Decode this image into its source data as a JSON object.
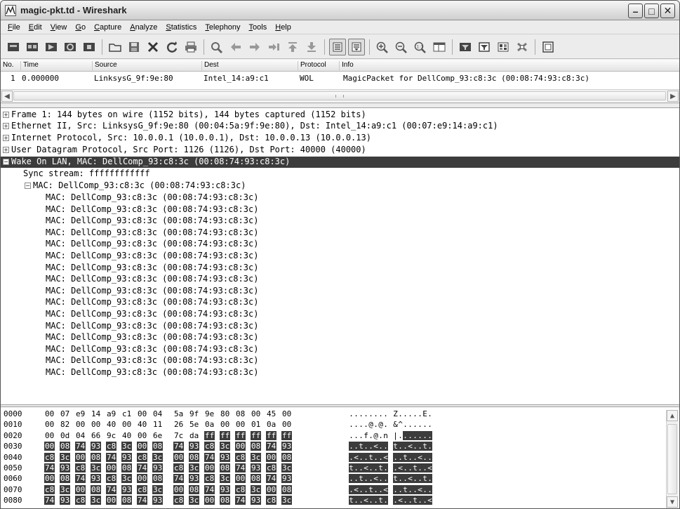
{
  "window": {
    "title": "magic-pkt.td - Wireshark"
  },
  "menu": [
    "File",
    "Edit",
    "View",
    "Go",
    "Capture",
    "Analyze",
    "Statistics",
    "Telephony",
    "Tools",
    "Help"
  ],
  "toolbar": {
    "icons": [
      "interface-list-icon",
      "capture-options-icon",
      "start-capture-icon",
      "restart-capture-icon",
      "stop-capture-icon",
      "open-file-icon",
      "save-file-icon",
      "close-file-icon",
      "reload-icon",
      "print-icon",
      "find-packet-icon",
      "go-back-icon",
      "go-forward-icon",
      "go-to-packet-icon",
      "go-first-icon",
      "go-last-icon",
      "colorize-icon",
      "autoscroll-icon",
      "zoom-in-icon",
      "zoom-out-icon",
      "zoom-normal-icon",
      "resize-columns-icon",
      "capture-filters-icon",
      "display-filters-icon",
      "coloring-rules-icon",
      "preferences-icon",
      "help-icon"
    ]
  },
  "packet_list": {
    "columns": [
      "No.",
      "Time",
      "Source",
      "Dest",
      "Protocol",
      "Info"
    ],
    "rows": [
      {
        "no": "1",
        "time": "0.000000",
        "source": "LinksysG_9f:9e:80",
        "dest": "Intel_14:a9:c1",
        "protocol": "WOL",
        "info": "MagicPacket for DellComp_93:c8:3c (00:08:74:93:c8:3c)"
      }
    ]
  },
  "details": {
    "frame": "Frame 1: 144 bytes on wire (1152 bits), 144 bytes captured (1152 bits)",
    "ethernet": "Ethernet II, Src: LinksysG_9f:9e:80 (00:04:5a:9f:9e:80), Dst: Intel_14:a9:c1 (00:07:e9:14:a9:c1)",
    "ip": "Internet Protocol, Src: 10.0.0.1 (10.0.0.1), Dst: 10.0.0.13 (10.0.0.13)",
    "udp": "User Datagram Protocol, Src Port: 1126 (1126), Dst Port: 40000 (40000)",
    "wol": "Wake On LAN, MAC: DellComp_93:c8:3c (00:08:74:93:c8:3c)",
    "sync": "Sync stream: ffffffffffff",
    "mac_group": "MAC: DellComp_93:c8:3c (00:08:74:93:c8:3c)",
    "mac_entries": [
      "MAC: DellComp_93:c8:3c (00:08:74:93:c8:3c)",
      "MAC: DellComp_93:c8:3c (00:08:74:93:c8:3c)",
      "MAC: DellComp_93:c8:3c (00:08:74:93:c8:3c)",
      "MAC: DellComp_93:c8:3c (00:08:74:93:c8:3c)",
      "MAC: DellComp_93:c8:3c (00:08:74:93:c8:3c)",
      "MAC: DellComp_93:c8:3c (00:08:74:93:c8:3c)",
      "MAC: DellComp_93:c8:3c (00:08:74:93:c8:3c)",
      "MAC: DellComp_93:c8:3c (00:08:74:93:c8:3c)",
      "MAC: DellComp_93:c8:3c (00:08:74:93:c8:3c)",
      "MAC: DellComp_93:c8:3c (00:08:74:93:c8:3c)",
      "MAC: DellComp_93:c8:3c (00:08:74:93:c8:3c)",
      "MAC: DellComp_93:c8:3c (00:08:74:93:c8:3c)",
      "MAC: DellComp_93:c8:3c (00:08:74:93:c8:3c)",
      "MAC: DellComp_93:c8:3c (00:08:74:93:c8:3c)",
      "MAC: DellComp_93:c8:3c (00:08:74:93:c8:3c)",
      "MAC: DellComp_93:c8:3c (00:08:74:93:c8:3c)"
    ]
  },
  "hex": {
    "rows": [
      {
        "offset": "0000",
        "bytes": [
          "00",
          "07",
          "e9",
          "14",
          "a9",
          "c1",
          "00",
          "04",
          "5a",
          "9f",
          "9e",
          "80",
          "08",
          "00",
          "45",
          "00"
        ],
        "ascii": "........Z.....E.",
        "sel_from": 16
      },
      {
        "offset": "0010",
        "bytes": [
          "00",
          "82",
          "00",
          "00",
          "40",
          "00",
          "40",
          "11",
          "26",
          "5e",
          "0a",
          "00",
          "00",
          "01",
          "0a",
          "00"
        ],
        "ascii": "....@.@.&^......",
        "sel_from": 16
      },
      {
        "offset": "0020",
        "bytes": [
          "00",
          "0d",
          "04",
          "66",
          "9c",
          "40",
          "00",
          "6e",
          "7c",
          "da",
          "ff",
          "ff",
          "ff",
          "ff",
          "ff",
          "ff"
        ],
        "ascii": "...f.@.n|.......",
        "sel_from": 10
      },
      {
        "offset": "0030",
        "bytes": [
          "00",
          "08",
          "74",
          "93",
          "c8",
          "3c",
          "00",
          "08",
          "74",
          "93",
          "c8",
          "3c",
          "00",
          "08",
          "74",
          "93"
        ],
        "ascii": "..t..<..t..<..t.",
        "sel_from": 0
      },
      {
        "offset": "0040",
        "bytes": [
          "c8",
          "3c",
          "00",
          "08",
          "74",
          "93",
          "c8",
          "3c",
          "00",
          "08",
          "74",
          "93",
          "c8",
          "3c",
          "00",
          "08"
        ],
        "ascii": ".<..t..<..t..<..",
        "sel_from": 0
      },
      {
        "offset": "0050",
        "bytes": [
          "74",
          "93",
          "c8",
          "3c",
          "00",
          "08",
          "74",
          "93",
          "c8",
          "3c",
          "00",
          "08",
          "74",
          "93",
          "c8",
          "3c"
        ],
        "ascii": "t..<..t..<..t..<",
        "sel_from": 0
      },
      {
        "offset": "0060",
        "bytes": [
          "00",
          "08",
          "74",
          "93",
          "c8",
          "3c",
          "00",
          "08",
          "74",
          "93",
          "c8",
          "3c",
          "00",
          "08",
          "74",
          "93"
        ],
        "ascii": "..t..<..t..<..t.",
        "sel_from": 0
      },
      {
        "offset": "0070",
        "bytes": [
          "c8",
          "3c",
          "00",
          "08",
          "74",
          "93",
          "c8",
          "3c",
          "00",
          "08",
          "74",
          "93",
          "c8",
          "3c",
          "00",
          "08"
        ],
        "ascii": ".<..t..<..t..<..",
        "sel_from": 0
      },
      {
        "offset": "0080",
        "bytes": [
          "74",
          "93",
          "c8",
          "3c",
          "00",
          "08",
          "74",
          "93",
          "c8",
          "3c",
          "00",
          "08",
          "74",
          "93",
          "c8",
          "3c"
        ],
        "ascii": "t..<..t..<..t..<",
        "sel_from": 0
      }
    ]
  },
  "colors": {
    "selection": "#3c3c3c",
    "selection_text": "#ffffff"
  }
}
